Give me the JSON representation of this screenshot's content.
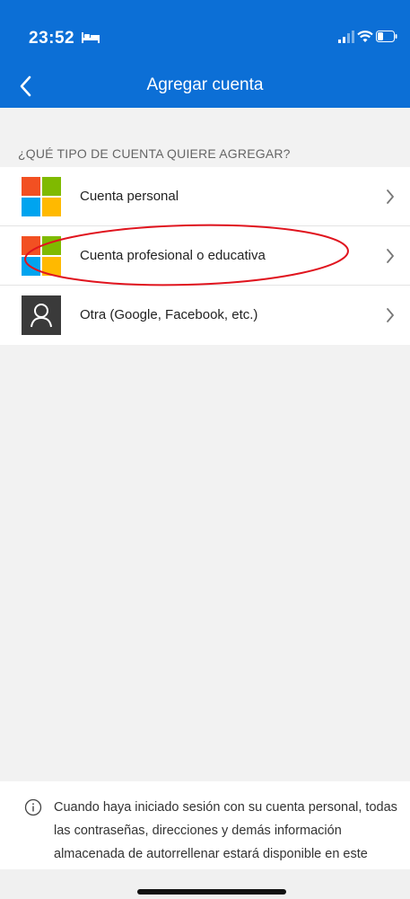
{
  "status_bar": {
    "time": "23:52",
    "icons": [
      "bed-icon",
      "signal-icon",
      "wifi-icon",
      "battery-icon"
    ]
  },
  "nav": {
    "title": "Agregar cuenta",
    "back_icon": "chevron-left-icon"
  },
  "section_label": "¿QUÉ TIPO DE CUENTA QUIERE AGREGAR?",
  "accounts": [
    {
      "label": "Cuenta personal",
      "icon": "microsoft-logo-icon"
    },
    {
      "label": "Cuenta profesional o educativa",
      "icon": "microsoft-logo-icon",
      "highlighted": true
    },
    {
      "label": "Otra (Google, Facebook, etc.)",
      "icon": "person-icon"
    }
  ],
  "footer": {
    "icon": "info-icon",
    "text": "Cuando haya iniciado sesión con su cuenta personal, todas las contraseñas, direcciones y demás información almacenada de autorrellenar estará disponible en este dispositivo."
  },
  "colors": {
    "header": "#0c6fd6",
    "highlight": "#e0141e",
    "ms_red": "#f25022",
    "ms_green": "#7fba00",
    "ms_blue": "#00a4ef",
    "ms_yellow": "#ffb900"
  }
}
